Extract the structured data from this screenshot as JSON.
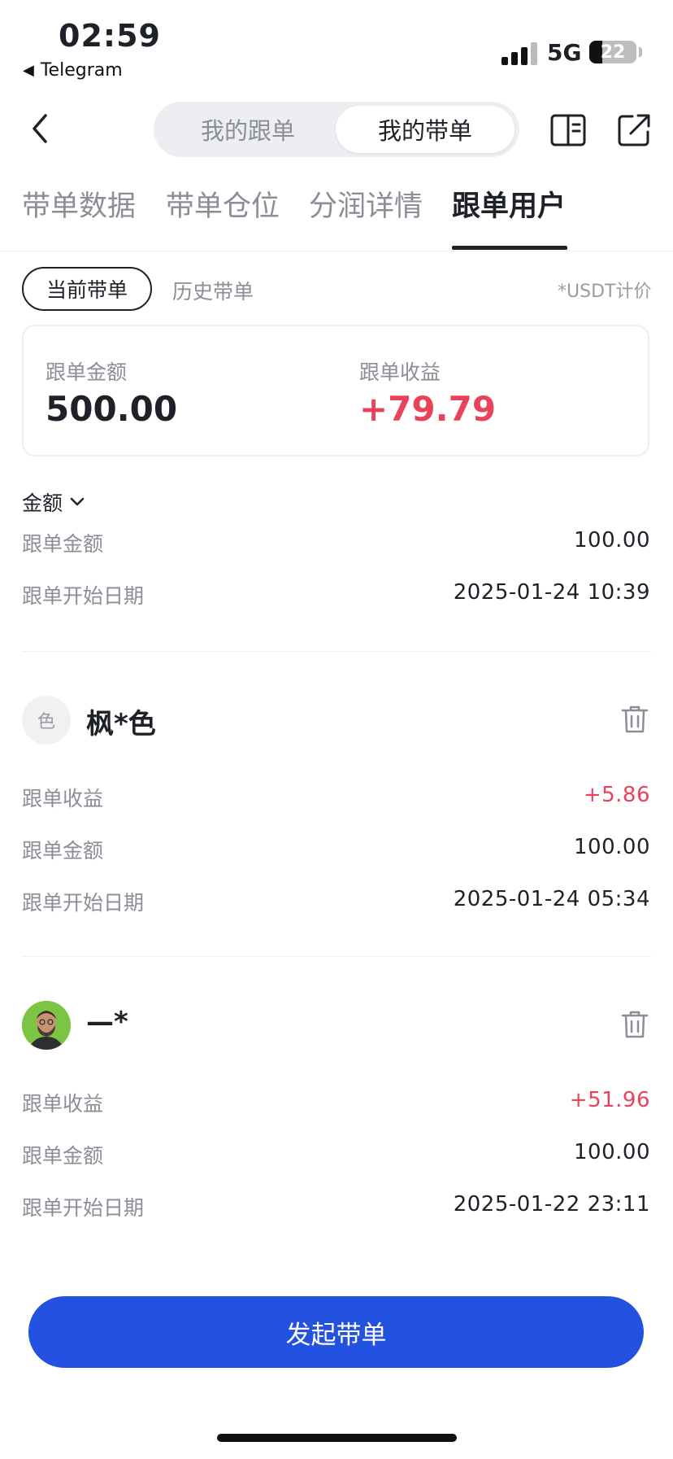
{
  "status_bar": {
    "time": "02:59",
    "back_app": "Telegram",
    "network": "5G",
    "battery": "22"
  },
  "header": {
    "segments": [
      "我的跟单",
      "我的带单"
    ],
    "active_segment": 1
  },
  "tabs": [
    "带单数据",
    "带单仓位",
    "分润详情",
    "跟单用户"
  ],
  "active_tab": 3,
  "sub_tabs": {
    "current": "当前带单",
    "history": "历史带单",
    "unit_note": "*USDT计价"
  },
  "summary": {
    "amount_label": "跟单金额",
    "amount_value": "500.00",
    "profit_label": "跟单收益",
    "profit_value": "+79.79"
  },
  "sort": {
    "label": "金额"
  },
  "first_entry": {
    "amount_label": "跟单金额",
    "amount_value": "100.00",
    "date_label": "跟单开始日期",
    "date_value": "2025-01-24 10:39"
  },
  "followers": [
    {
      "avatar_text": "色",
      "name": "枫*色",
      "profit_label": "跟单收益",
      "profit_value": "+5.86",
      "amount_label": "跟单金额",
      "amount_value": "100.00",
      "date_label": "跟单开始日期",
      "date_value": "2025-01-24 05:34"
    },
    {
      "avatar_text": "",
      "name": "—*",
      "profit_label": "跟单收益",
      "profit_value": "+51.96",
      "amount_label": "跟单金额",
      "amount_value": "100.00",
      "date_label": "跟单开始日期",
      "date_value": "2025-01-22 23:11"
    }
  ],
  "cta": {
    "label": "发起带单"
  },
  "colors": {
    "accent": "#2352e0",
    "profit": "#e8435a",
    "text": "#1f2128",
    "muted": "#8b8e96"
  }
}
